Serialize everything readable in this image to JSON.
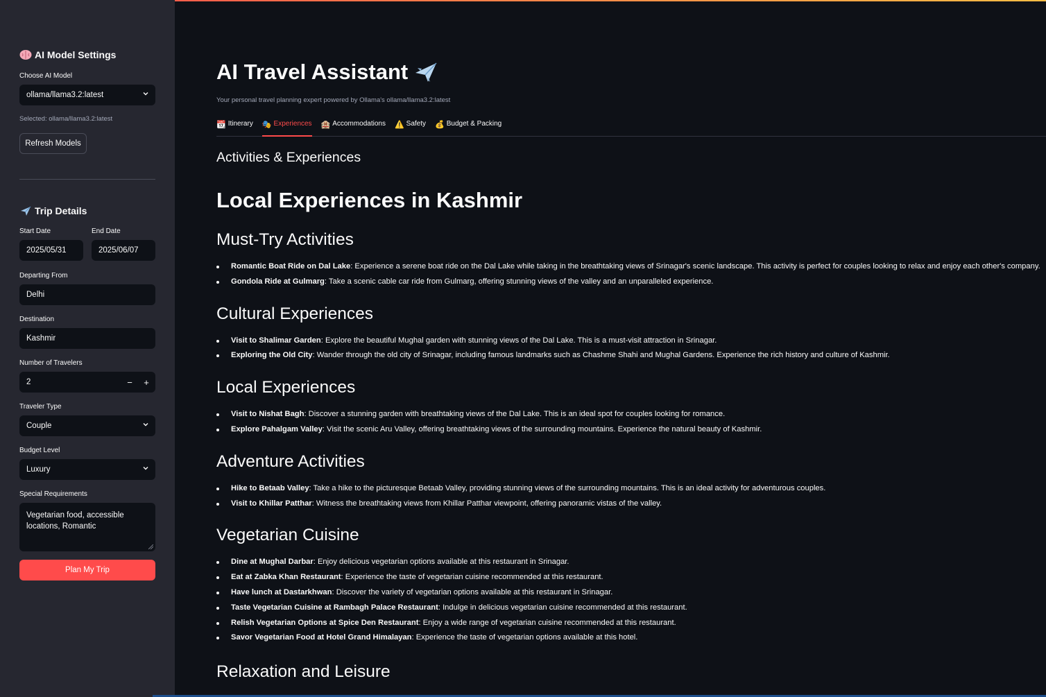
{
  "sidebar": {
    "model_section": {
      "icon": "brain-icon",
      "heading": "AI Model Settings",
      "choose_label": "Choose AI Model",
      "selected_model": "ollama/llama3.2:latest",
      "selected_caption": "Selected: ollama/llama3.2:latest",
      "refresh_label": "Refresh Models"
    },
    "trip_section": {
      "icon": "airplane-icon",
      "heading": "Trip Details",
      "start_date_label": "Start Date",
      "start_date": "2025/05/31",
      "end_date_label": "End Date",
      "end_date": "2025/06/07",
      "departing_label": "Departing From",
      "departing": "Delhi",
      "destination_label": "Destination",
      "destination": "Kashmir",
      "travelers_label": "Number of Travelers",
      "travelers": "2",
      "minus": "−",
      "plus": "+",
      "traveler_type_label": "Traveler Type",
      "traveler_type": "Couple",
      "budget_label": "Budget Level",
      "budget": "Luxury",
      "special_label": "Special Requirements",
      "special_line1": "Vegetarian food, accessible",
      "special_line2": "locations, Romantic",
      "plan_label": "Plan My Trip"
    }
  },
  "main": {
    "title": "AI Travel Assistant",
    "title_icon": "airplane-icon",
    "subtitle": "Your personal travel planning expert powered by Ollama's ollama/llama3.2:latest",
    "tabs": [
      {
        "icon": "calendar-icon",
        "glyph": "📆",
        "label": "Itinerary"
      },
      {
        "icon": "masks-icon",
        "glyph": "🎭",
        "label": "Experiences"
      },
      {
        "icon": "hotel-icon",
        "glyph": "🏨",
        "label": "Accommodations"
      },
      {
        "icon": "warning-icon",
        "glyph": "⚠️",
        "label": "Safety"
      },
      {
        "icon": "money-bag-icon",
        "glyph": "💰",
        "label": "Budget & Packing"
      }
    ],
    "active_tab": "Experiences",
    "section_heading": "Activities & Experiences",
    "doc_title": "Local Experiences in Kashmir",
    "sections": [
      {
        "heading": "Must-Try Activities",
        "items": [
          {
            "bold": "Romantic Boat Ride on Dal Lake",
            "text": ": Experience a serene boat ride on the Dal Lake while taking in the breathtaking views of Srinagar's scenic landscape. This activity is perfect for couples looking to relax and enjoy each other's company."
          },
          {
            "bold": "Gondola Ride at Gulmarg",
            "text": ": Take a scenic cable car ride from Gulmarg, offering stunning views of the valley and an unparalleled experience."
          }
        ]
      },
      {
        "heading": "Cultural Experiences",
        "items": [
          {
            "bold": "Visit to Shalimar Garden",
            "text": ": Explore the beautiful Mughal garden with stunning views of the Dal Lake. This is a must-visit attraction in Srinagar."
          },
          {
            "bold": "Exploring the Old City",
            "text": ": Wander through the old city of Srinagar, including famous landmarks such as Chashme Shahi and Mughal Gardens. Experience the rich history and culture of Kashmir."
          }
        ]
      },
      {
        "heading": "Local Experiences",
        "items": [
          {
            "bold": "Visit to Nishat Bagh",
            "text": ": Discover a stunning garden with breathtaking views of the Dal Lake. This is an ideal spot for couples looking for romance."
          },
          {
            "bold": "Explore Pahalgam Valley",
            "text": ": Visit the scenic Aru Valley, offering breathtaking views of the surrounding mountains. Experience the natural beauty of Kashmir."
          }
        ]
      },
      {
        "heading": "Adventure Activities",
        "items": [
          {
            "bold": "Hike to Betaab Valley",
            "text": ": Take a hike to the picturesque Betaab Valley, providing stunning views of the surrounding mountains. This is an ideal activity for adventurous couples."
          },
          {
            "bold": "Visit to Khillar Patthar",
            "text": ": Witness the breathtaking views from Khillar Patthar viewpoint, offering panoramic vistas of the valley."
          }
        ]
      },
      {
        "heading": "Vegetarian Cuisine",
        "items": [
          {
            "bold": "Dine at Mughal Darbar",
            "text": ": Enjoy delicious vegetarian options available at this restaurant in Srinagar."
          },
          {
            "bold": "Eat at Zabka Khan Restaurant",
            "text": ": Experience the taste of vegetarian cuisine recommended at this restaurant."
          },
          {
            "bold": "Have lunch at Dastarkhwan",
            "text": ": Discover the variety of vegetarian options available at this restaurant in Srinagar."
          },
          {
            "bold": "Taste Vegetarian Cuisine at Rambagh Palace Restaurant",
            "text": ": Indulge in delicious vegetarian cuisine recommended at this restaurant."
          },
          {
            "bold": "Relish Vegetarian Options at Spice Den Restaurant",
            "text": ": Enjoy a wide range of vegetarian cuisine recommended at this restaurant."
          },
          {
            "bold": "Savor Vegetarian Food at Hotel Grand Himalayan",
            "text": ": Experience the taste of vegetarian options available at this hotel."
          }
        ]
      },
      {
        "heading": "Relaxation and Leisure",
        "items": []
      }
    ]
  },
  "colors": {
    "background": "#0e1117",
    "sidebar": "#262730",
    "accent": "#ff4b4b",
    "muted_text": "#a3a8b8"
  }
}
